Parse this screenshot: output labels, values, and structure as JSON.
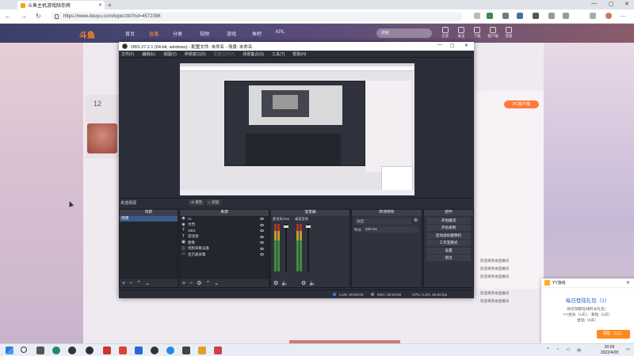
{
  "browser": {
    "tab_title": "斗鱼主机游戏陪你爽",
    "new_tab": "+",
    "url": "https://www.douyu.com/topic/zfd?rid=4572396",
    "min": "—",
    "max": "▢",
    "close": "✕"
  },
  "site": {
    "logo": "斗鱼",
    "nav": [
      "首页",
      "直播",
      "分类",
      "视频",
      "游戏",
      "鱼吧",
      "KPL"
    ],
    "search_placeholder": "搜索",
    "header_icons": [
      "历史",
      "关注",
      "下载",
      "客户端",
      "消息"
    ],
    "anchor_number": "12",
    "side_badge": "PC客户端",
    "chat_lines": [
      "欢迎来到本直播间",
      "欢迎来到本直播间",
      "欢迎来到本直播间",
      "欢迎来到本直播间",
      "欢迎来到本直播间"
    ]
  },
  "obs": {
    "title": "OBS 27.2.1 (64-bit, windows) - 配置文件: 未命名 - 场景: 未命名",
    "menu": [
      "文件(F)",
      "编辑(E)",
      "视图(V)",
      "停靠窗口(D)",
      "配置文件(P)",
      "场景集合(S)",
      "工具(T)",
      "帮助(H)"
    ],
    "no_source": "未选择源",
    "properties": "属性",
    "filters": "滤镜",
    "docks": {
      "scenes": "场景",
      "sources": "来源",
      "mixer": "混音器",
      "transitions": "转场特效",
      "controls": "控件"
    },
    "scene_item": "场景",
    "sources": [
      "cs",
      "文档",
      "OBS",
      "游戏源",
      "图像",
      "视频采集设备",
      "显示器采集"
    ],
    "mixer_channels": [
      "麦克风/Aux",
      "桌面音频"
    ],
    "transition_type": "淡出",
    "duration_label": "时长",
    "duration_value": "400 ms",
    "controls": [
      "开始推流",
      "开始录制",
      "启动虚拟摄像机",
      "工作室模式",
      "设置",
      "退出"
    ],
    "footer_buttons": [
      "+",
      "−",
      "⌃",
      "⌄"
    ],
    "status": {
      "live": "LIVE: 00:00:00",
      "rec": "REC: 00:00:00",
      "cpu": "CPU: 3.4%, 60.00 fps"
    }
  },
  "notification": {
    "app": "YY游戏",
    "title": "每日登陆礼包（1）",
    "body": [
      "你可领取在线时长礼包：",
      "YY会员（1天）、紫钻（2天）",
      "金钻（3天）"
    ],
    "button": "领取（1/1）"
  },
  "taskbar": {
    "time": "20:09",
    "date": "2022/4/28",
    "lang": "中"
  },
  "colors": {
    "accent": "#ff8a1c",
    "obs_bg": "#2b2e38",
    "link": "#2a62c9"
  }
}
